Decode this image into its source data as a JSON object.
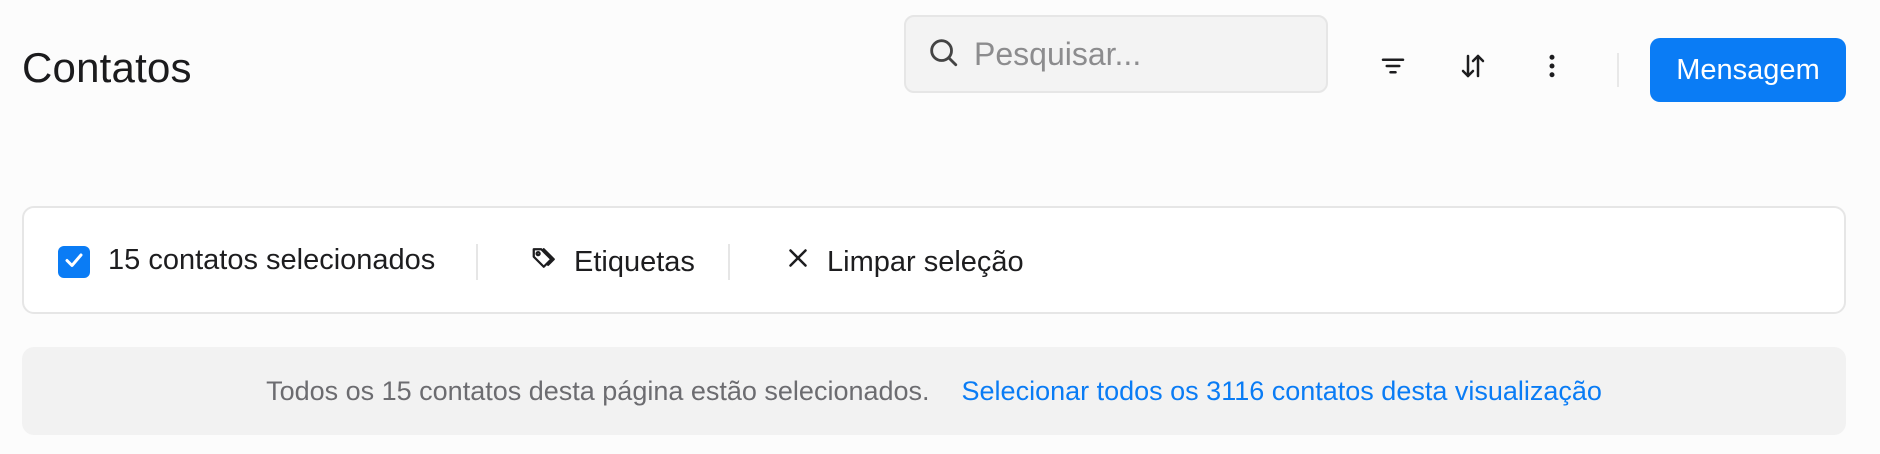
{
  "header": {
    "title": "Contatos",
    "search_placeholder": "Pesquisar...",
    "search_value": "",
    "icons": [
      "search-icon",
      "filter-icon",
      "sort-icon",
      "more-vertical-icon"
    ],
    "primary_button_label": "Mensagem"
  },
  "selection_bar": {
    "checked": true,
    "count_label": "15 contatos selecionados",
    "tags_label": "Etiquetas",
    "tags_icon": "tag-icon",
    "clear_label": "Limpar seleção",
    "clear_icon": "close-icon"
  },
  "banner": {
    "text": "Todos os 15 contatos desta página estão selecionados.",
    "link_label": "Selecionar todos os 3116 contatos desta visualização"
  },
  "colors": {
    "accent": "#0a7cf5",
    "background": "#fcfcfc",
    "banner_background": "#f2f2f2"
  }
}
